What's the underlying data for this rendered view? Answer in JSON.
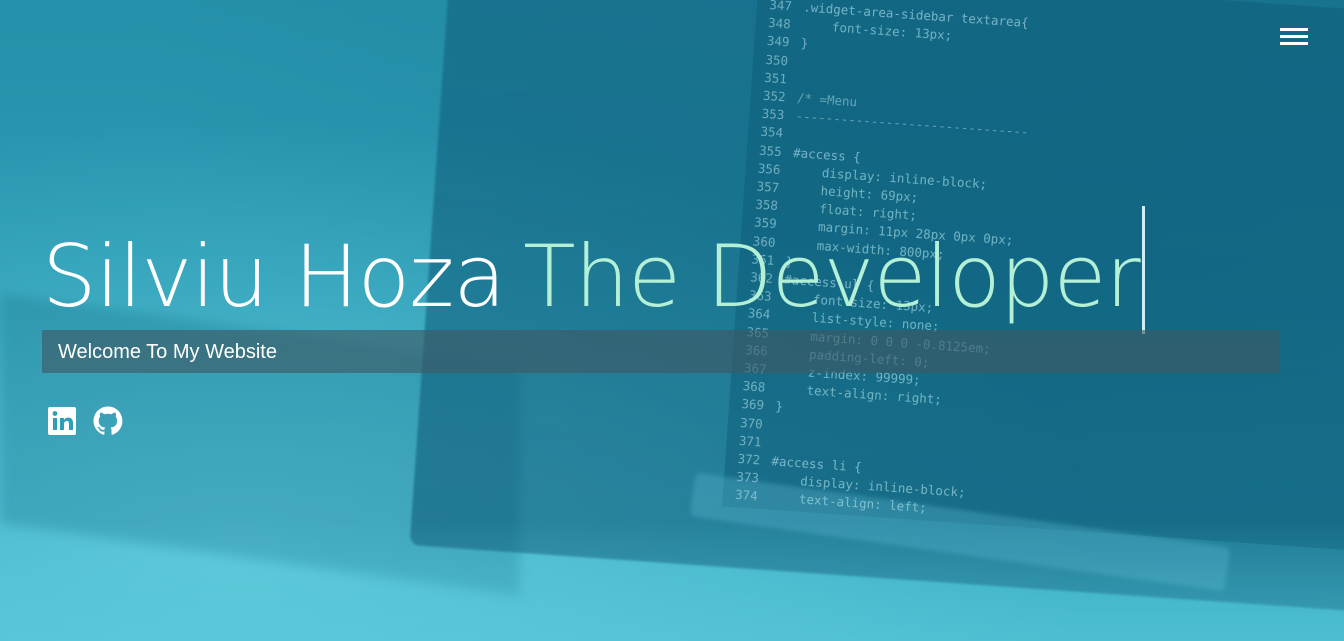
{
  "hero": {
    "name": "Silviu Hoza",
    "role": "The Developer",
    "welcome": "Welcome To My Website"
  },
  "nav": {
    "menu_icon": "hamburger-menu-icon"
  },
  "social": [
    {
      "icon": "linkedin-icon"
    },
    {
      "icon": "github-icon"
    }
  ],
  "background_code": [
    {
      "n": "347",
      "t": ".widget-area-sidebar textarea{"
    },
    {
      "n": "348",
      "t": "    font-size: 13px;"
    },
    {
      "n": "349",
      "t": "}"
    },
    {
      "n": "350",
      "t": ""
    },
    {
      "n": "351",
      "t": ""
    },
    {
      "n": "352",
      "t": "/* =Menu"
    },
    {
      "n": "353",
      "t": "-------------------------------"
    },
    {
      "n": "354",
      "t": ""
    },
    {
      "n": "355",
      "t": "#access {"
    },
    {
      "n": "356",
      "t": "    display: inline-block;"
    },
    {
      "n": "357",
      "t": "    height: 69px;"
    },
    {
      "n": "358",
      "t": "    float: right;"
    },
    {
      "n": "359",
      "t": "    margin: 11px 28px 0px 0px;"
    },
    {
      "n": "360",
      "t": "    max-width: 800px;"
    },
    {
      "n": "361",
      "t": "}"
    },
    {
      "n": "362",
      "t": "#access ul {"
    },
    {
      "n": "363",
      "t": "    font-size: 13px;"
    },
    {
      "n": "364",
      "t": "    list-style: none;"
    },
    {
      "n": "365",
      "t": "    margin: 0 0 0 -0.8125em;"
    },
    {
      "n": "366",
      "t": "    padding-left: 0;"
    },
    {
      "n": "367",
      "t": "    z-index: 99999;"
    },
    {
      "n": "368",
      "t": "    text-align: right;"
    },
    {
      "n": "369",
      "t": "}"
    },
    {
      "n": "370",
      "t": ""
    },
    {
      "n": "371",
      "t": ""
    },
    {
      "n": "372",
      "t": "#access li {"
    },
    {
      "n": "373",
      "t": "    display: inline-block;"
    },
    {
      "n": "374",
      "t": "    text-align: left;"
    }
  ],
  "colors": {
    "accent_role": "#b4f0d6",
    "welcome_bar": "#3e5864",
    "background": "#2a9fb5"
  }
}
